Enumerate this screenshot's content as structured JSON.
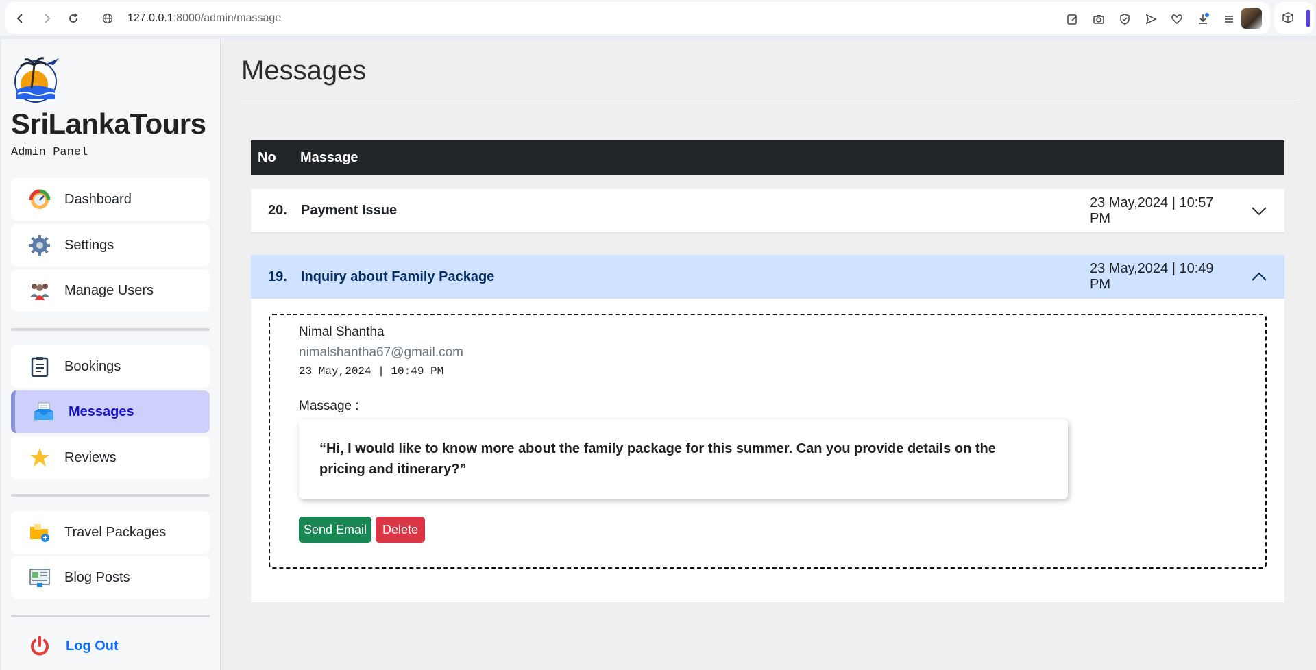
{
  "browser": {
    "url_host": "127.0.0.1",
    "url_path": ":8000/admin/massage"
  },
  "sidebar": {
    "brand": "SriLankaTours",
    "subtitle": "Admin Panel",
    "group1": [
      {
        "label": "Dashboard",
        "icon": "gauge-icon"
      },
      {
        "label": "Settings",
        "icon": "gear-icon"
      },
      {
        "label": "Manage Users",
        "icon": "users-icon"
      }
    ],
    "group2": [
      {
        "label": "Bookings",
        "icon": "clipboard-icon"
      },
      {
        "label": "Messages",
        "icon": "inbox-icon",
        "active": true
      },
      {
        "label": "Reviews",
        "icon": "star-icon"
      }
    ],
    "group3": [
      {
        "label": "Travel Packages",
        "icon": "folder-plus-icon"
      },
      {
        "label": "Blog Posts",
        "icon": "blog-icon"
      }
    ],
    "logout": "Log Out"
  },
  "main": {
    "title": "Messages",
    "table_head": {
      "no": "No",
      "massage": "Massage"
    },
    "rows": [
      {
        "num": "20.",
        "subject": "Payment Issue",
        "date": "23 May,2024 | 10:57 PM",
        "expanded": false
      },
      {
        "num": "19.",
        "subject": "Inquiry about Family Package",
        "date": "23 May,2024 | 10:49 PM",
        "expanded": true
      }
    ],
    "detail": {
      "sender": "Nimal Shantha",
      "email": "nimalshantha67@gmail.com",
      "timestamp": "23 May,2024 | 10:49 PM",
      "label": "Massage :",
      "message": "“Hi, I would like to know more about the family package for this summer. Can you provide details on the pricing and itinerary?”",
      "send_email": "Send Email",
      "delete": "Delete"
    }
  },
  "colors": {
    "active_nav_bg": "#cdd0fb",
    "active_nav_text": "#1a10c9",
    "table_head_bg": "#212529",
    "expanded_row_bg": "#cfe2ff",
    "send_btn": "#198754",
    "delete_btn": "#dc3545",
    "logout": "#0d6efd"
  }
}
